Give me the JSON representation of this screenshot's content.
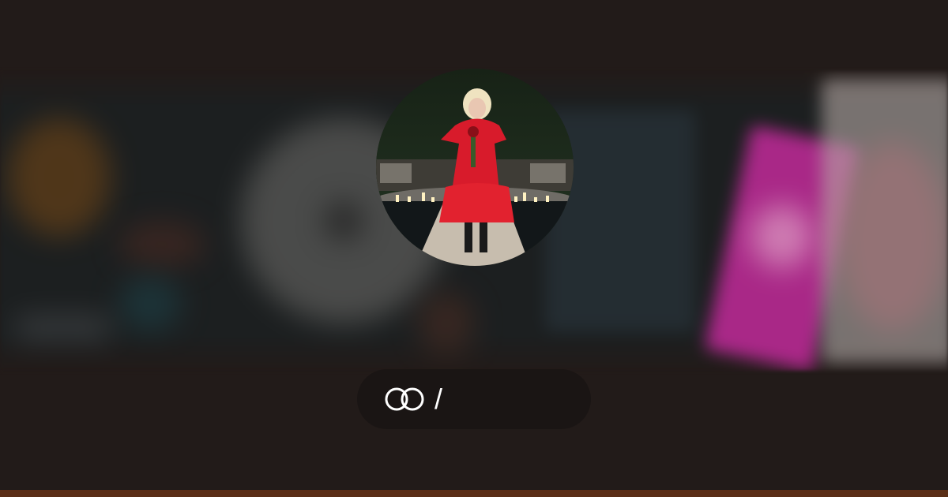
{
  "pill": {
    "logo_icon": "linked-rings-icon",
    "separator": "/"
  },
  "colors": {
    "background": "#221b19",
    "pill": "#1a1514",
    "footer_bar": "#5a2e16"
  }
}
